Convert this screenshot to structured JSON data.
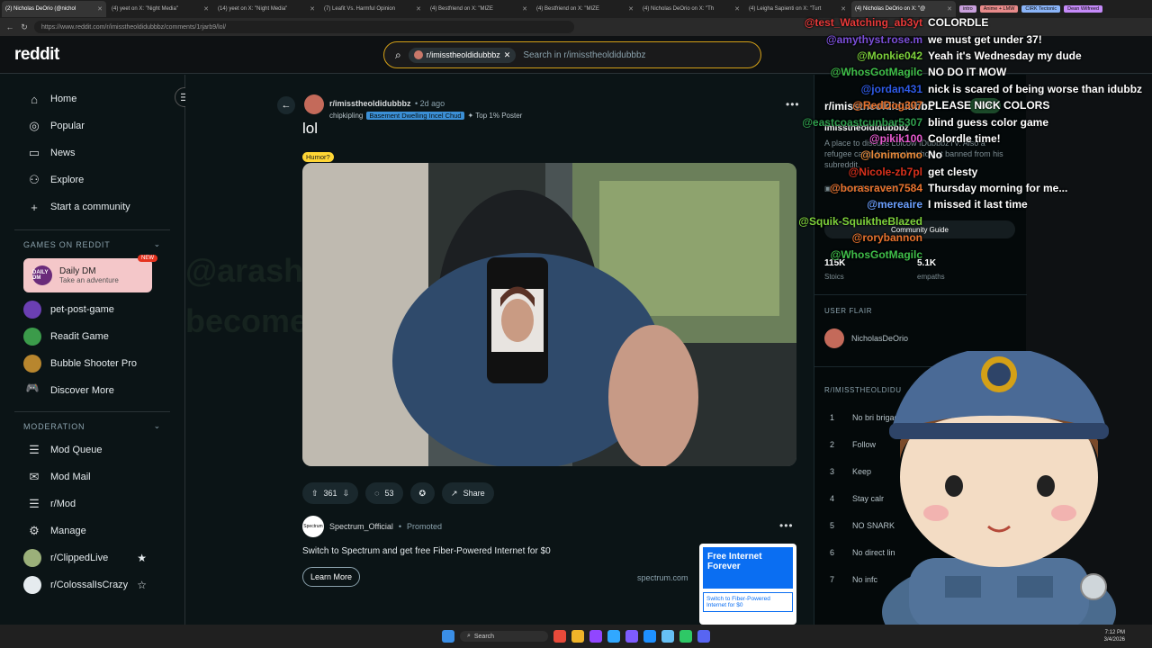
{
  "browser": {
    "tabs": [
      {
        "label": "(2) Nicholas DeOrio (@nichol"
      },
      {
        "label": "(4) yeet on X: \"Night Media\""
      },
      {
        "label": "(14) yeet on X: \"Night Media\""
      },
      {
        "label": "(7) Leafit Vs. Harmful Opinion"
      },
      {
        "label": "(4) Bestfriend on X: \"MIZE"
      },
      {
        "label": "(4) Bestfriend on X: \"MIZE"
      },
      {
        "label": "(4) Nicholas DeOrio on X: \"Th"
      },
      {
        "label": "(4) Leigha Sapienti on X: \"Turt"
      },
      {
        "label": "(4) Nicholas DeOrio on X: \"@"
      }
    ],
    "pills": [
      {
        "label": "intro",
        "color": "#c9a0dc"
      },
      {
        "label": "Anime + LMW",
        "color": "#e88a8a"
      },
      {
        "label": "CIRK Tectonic",
        "color": "#8ab4f8"
      },
      {
        "label": "Dean Wilfreed",
        "color": "#c58af9"
      }
    ],
    "url": "https://www.reddit.com/r/imisstheoldidubbbz/comments/1rjarb9/lol/"
  },
  "header": {
    "logo": "reddit",
    "search_chip": "r/imisstheoldidubbbz",
    "search_placeholder": "Search in r/imisstheoldidubbbz"
  },
  "sidebar": {
    "nav": [
      {
        "label": "Home",
        "icon": "home-icon",
        "glyph": "⌂"
      },
      {
        "label": "Popular",
        "icon": "popular-icon",
        "glyph": "◎"
      },
      {
        "label": "News",
        "icon": "news-icon",
        "glyph": "▭"
      },
      {
        "label": "Explore",
        "icon": "explore-icon",
        "glyph": "⚇"
      },
      {
        "label": "Start a community",
        "icon": "plus-icon",
        "glyph": "+"
      }
    ],
    "games_title": "GAMES ON REDDIT",
    "featured_game": {
      "title": "Daily DM",
      "subtitle": "Take an adventure",
      "badge": "NEW",
      "icon_text": "DAILY DM"
    },
    "games": [
      {
        "label": "pet-post-game",
        "color": "#6b3fb3"
      },
      {
        "label": "Readit Game",
        "color": "#3b9b4a"
      },
      {
        "label": "Bubble Shooter Pro",
        "color": "#b8862e"
      },
      {
        "label": "Discover More",
        "color": ""
      }
    ],
    "moderation_title": "MODERATION",
    "moderation": [
      {
        "label": "Mod Queue",
        "glyph": "☰"
      },
      {
        "label": "Mod Mail",
        "glyph": "✉"
      },
      {
        "label": "r/Mod",
        "glyph": "☰"
      },
      {
        "label": "Manage",
        "glyph": "⚙"
      },
      {
        "label": "r/ClippedLive",
        "glyph": "★"
      },
      {
        "label": "r/ColossalIsCrazy",
        "glyph": "☆"
      }
    ]
  },
  "post": {
    "subreddit": "r/imisstheoldidubbbz",
    "time": "• 2d ago",
    "author": "chipkipling",
    "author_flair": "Basement Dwelling Incel Chud",
    "top_poster": "Top 1% Poster",
    "title": "lol",
    "tag": "Humor?",
    "votes": "361",
    "comments": "53",
    "share": "Share"
  },
  "promo": {
    "name": "Spectrum_Official",
    "label": "Promoted",
    "text": "Switch to Spectrum and get free Fiber-Powered Internet for $0",
    "button": "Learn More",
    "domain": "spectrum.com",
    "img_headline": "Free Internet Forever",
    "img_cta": "Switch to Fiber-Powered Internet for $0",
    "avatar_text": "Spectrum"
  },
  "rail": {
    "title": "r/imisstheoldidubbbz",
    "name": "imisstheoldidubbbz",
    "join": "Join",
    "description": "A place to discuss Lolcow IDubbbzTV. Also a refugee camp for people who got banned from his subreddit.",
    "created": "Created Jun 5, 2025",
    "guide": "Community Guide",
    "members": "115K",
    "members_label": "Stoics",
    "online": "5.1K",
    "online_label": "empaths",
    "user_flair_title": "USER FLAIR",
    "user_flair_name": "NicholasDeOrio",
    "rules_title": "R/IMISSTHEOLDIDU",
    "rules": [
      {
        "num": "1",
        "text": "No bri brigadi"
      },
      {
        "num": "2",
        "text": "Follow"
      },
      {
        "num": "3",
        "text": "Keep"
      },
      {
        "num": "4",
        "text": "Stay calr"
      },
      {
        "num": "5",
        "text": "NO SNARK"
      },
      {
        "num": "6",
        "text": "No direct lin"
      },
      {
        "num": "7",
        "text": "No infc"
      }
    ]
  },
  "chat": [
    {
      "user": "@test_Watching_ab3yt",
      "msg": "COLORDLE",
      "color": "#e83a3a"
    },
    {
      "user": "@amythyst.rose.m",
      "msg": "we must get under 37!",
      "color": "#7b4fd9"
    },
    {
      "user": "@Monkie042",
      "msg": "Yeah it's Wednesday my dude",
      "color": "#7dd13b"
    },
    {
      "user": "@WhosGotMagilc",
      "msg": "NO DO IT MOW",
      "color": "#3fbf4a"
    },
    {
      "user": "@jordan431",
      "msg": "nick is scared of being worse than idubbz",
      "color": "#2e5be8"
    },
    {
      "user": "@RedDog307",
      "msg": "PLEASE NICK COLORS",
      "color": "#e8732e"
    },
    {
      "user": "@eastcoastcunbar5307",
      "msg": "blind guess color game",
      "color": "#2f9e4e"
    },
    {
      "user": "@pikik100",
      "msg": "Colordle time!",
      "color": "#e85bd1"
    },
    {
      "user": "@lonimomo",
      "msg": "No",
      "color": "#e88a3a"
    },
    {
      "user": "@Nicole-zb7pl",
      "msg": "get clesty",
      "color": "#d9311c"
    },
    {
      "user": "@borasraven7584",
      "msg": "Thursday morning for me...",
      "color": "#e8732e"
    },
    {
      "user": "@mereaire",
      "msg": "I missed it last time",
      "color": "#6ba0ff"
    },
    {
      "user": "@Squik-SquiktheBlazed",
      "msg": "",
      "color": "#7dd13b"
    },
    {
      "user": "@rorybannon",
      "msg": "",
      "color": "#e8732e"
    },
    {
      "user": "@WhosGotMagilc",
      "msg": "",
      "color": "#3fbf4a"
    }
  ],
  "taskbar": {
    "search": "Search",
    "time": "7:12 PM",
    "date": "3/4/2026"
  },
  "watermark": {
    "line1": "@arashet",
    "line2": "become a me"
  },
  "colors": {
    "accent": "#d4a017",
    "bg": "#0b1416",
    "flair": "#3b8fd6"
  }
}
